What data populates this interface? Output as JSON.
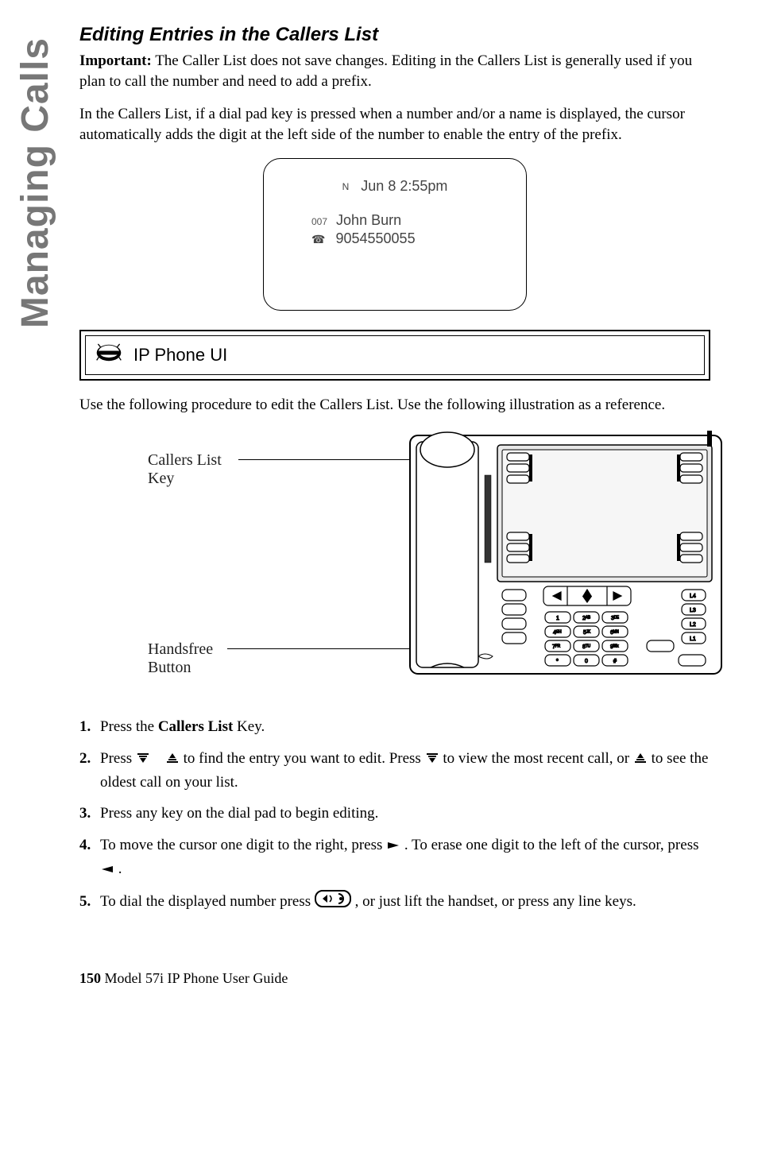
{
  "sidebar_tab": "Managing Calls",
  "heading": "Editing Entries in the Callers List",
  "intro_bold": "Important:",
  "intro_rest": " The Caller List does not save changes. Editing in the Callers List is generally used if you plan to call the number and need to add a prefix.",
  "para2": "In the Callers List, if a dial pad key is pressed when a number and/or a name is displayed, the cursor automatically adds the digit at the left side of the number to enable the entry of the prefix.",
  "screen": {
    "status_n": "N",
    "datetime": "Jun 8 2:55pm",
    "entry_index": "007",
    "entry_name": "John Burn",
    "entry_number": "9054550055"
  },
  "ui_box_label": "IP Phone UI",
  "para3": "Use the following procedure to edit the Callers List. Use the following illustration as a reference.",
  "illus": {
    "callers_label": "Callers List\nKey",
    "handsfree_label": "Handsfree\nButton"
  },
  "steps": {
    "s1_a": "Press the ",
    "s1_b": "Callers List",
    "s1_c": " Key.",
    "s2_a": "Press ",
    "s2_b": " to find the entry you want to edit. Press ",
    "s2_c": " to view the most recent call, or ",
    "s2_d": " to see the oldest call on your list.",
    "s3": "Press any key on the dial pad to begin editing.",
    "s4_a": "To move the cursor one digit to the right, press ",
    "s4_b": " . To erase one digit to the left of the cursor, press ",
    "s4_c": " .",
    "s5_a": "To dial the displayed number press ",
    "s5_b": ", or just lift the handset, or press any line keys."
  },
  "footer": {
    "page": "150",
    "title": "  Model 57i IP Phone User Guide"
  }
}
